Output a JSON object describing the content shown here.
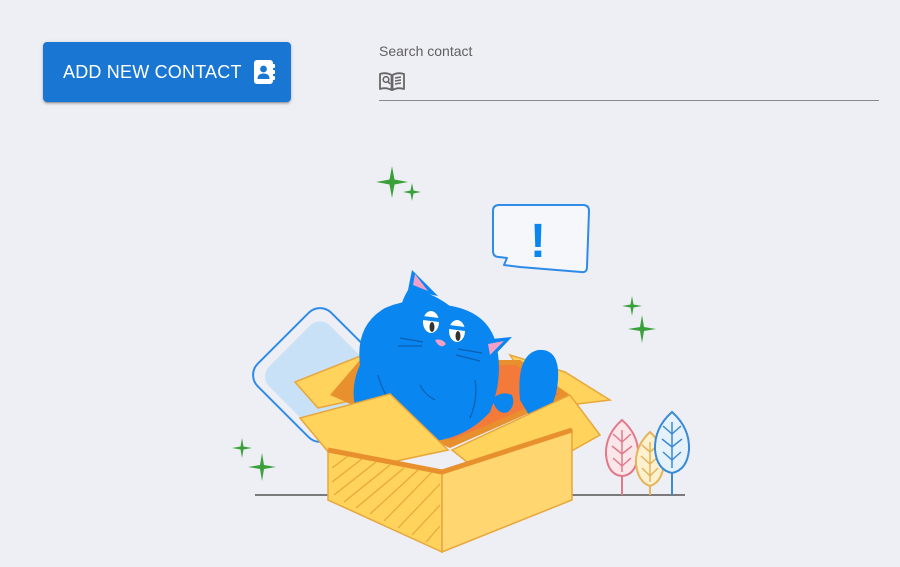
{
  "toolbar": {
    "add_contact_label": "ADD NEW CONTACT",
    "add_contact_icon": "contact-book-icon"
  },
  "search": {
    "label": "Search contact",
    "placeholder": "",
    "value": "",
    "icon": "contact-search-icon"
  },
  "empty_state": {
    "illustration": "cat-in-box-illustration",
    "speech_bubble_text": "!"
  },
  "colors": {
    "background": "#eeeef5",
    "primary_button": "#1976d2",
    "cat_blue": "#0a86f0",
    "box_yellow": "#ffd35c",
    "box_orange": "#f0a830",
    "sparkle_green": "#3aa13a"
  }
}
